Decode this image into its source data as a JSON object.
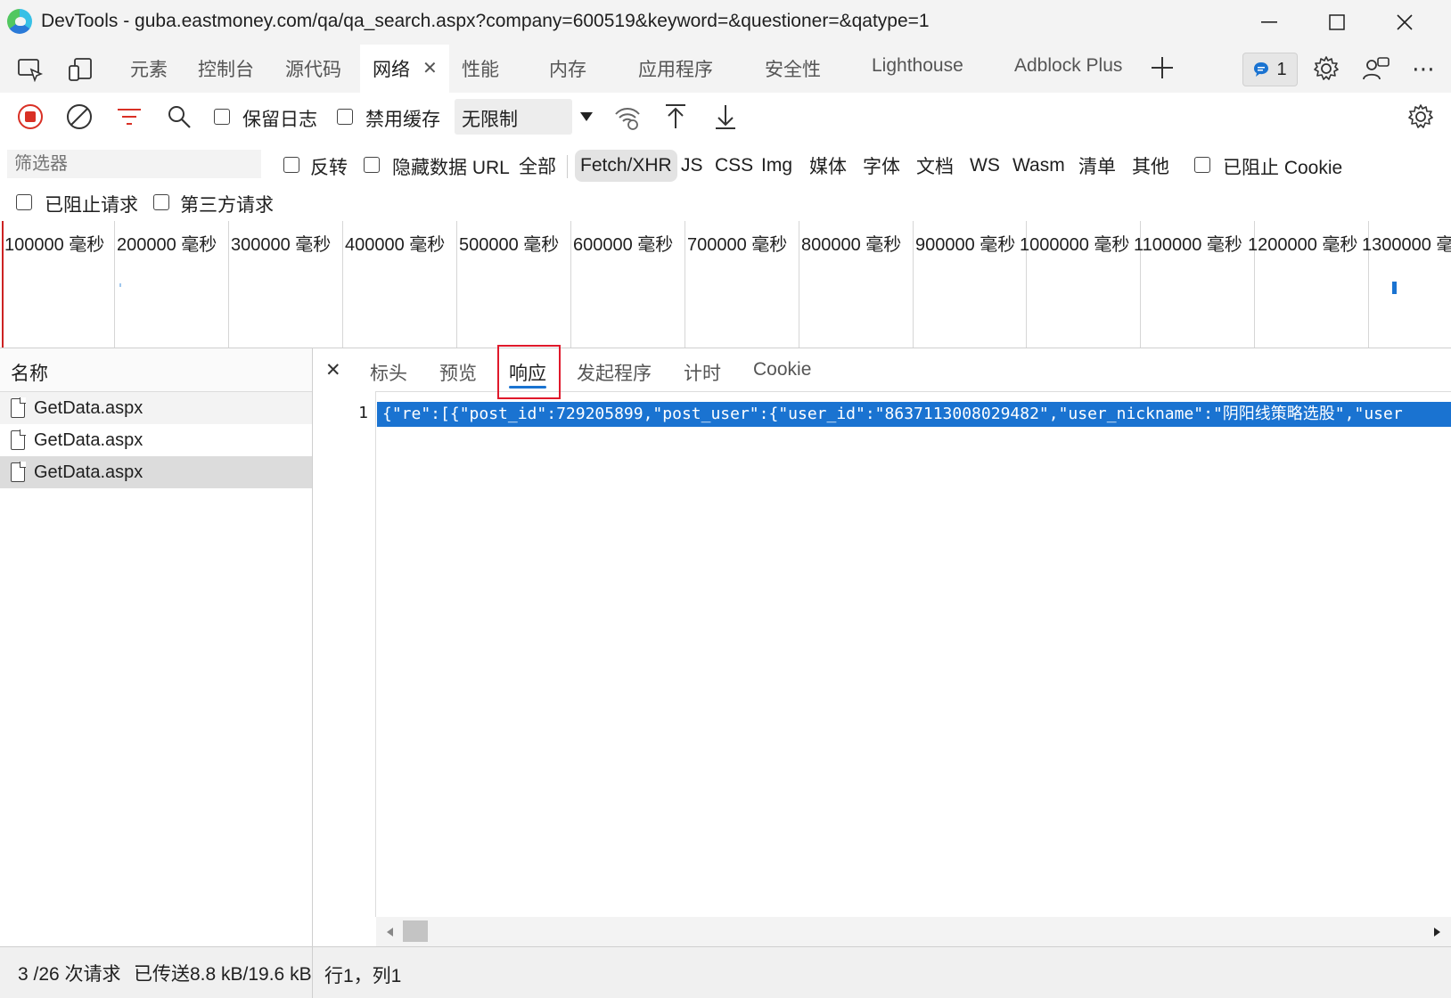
{
  "window": {
    "title": "DevTools - guba.eastmoney.com/qa/qa_search.aspx?company=600519&keyword=&questioner=&qatype=1",
    "minimize": "—",
    "maximize": "☐",
    "close": "✕"
  },
  "tabs": [
    {
      "label": "元素"
    },
    {
      "label": "控制台"
    },
    {
      "label": "源代码"
    },
    {
      "label": "网络",
      "active": true
    },
    {
      "label": "性能"
    },
    {
      "label": "内存"
    },
    {
      "label": "应用程序"
    },
    {
      "label": "安全性"
    },
    {
      "label": "Lighthouse"
    },
    {
      "label": "Adblock Plus"
    }
  ],
  "tab_close": "✕",
  "add_tab": "+",
  "messages_count": "1",
  "toolbar": {
    "preserve_log": "保留日志",
    "disable_cache": "禁用缓存",
    "throttling": "无限制"
  },
  "filter": {
    "placeholder": "筛选器",
    "invert": "反转",
    "hide_data_urls": "隐藏数据 URL",
    "types": [
      "全部",
      "Fetch/XHR",
      "JS",
      "CSS",
      "Img",
      "媒体",
      "字体",
      "文档",
      "WS",
      "Wasm",
      "清单",
      "其他"
    ],
    "active_type": "Fetch/XHR",
    "blocked_cookies": "已阻止 Cookie",
    "blocked_requests": "已阻止请求",
    "third_party": "第三方请求"
  },
  "overview": {
    "ticks": [
      "100000 毫秒",
      "200000 毫秒",
      "300000 毫秒",
      "400000 毫秒",
      "500000 毫秒",
      "600000 毫秒",
      "700000 毫秒",
      "800000 毫秒",
      "900000 毫秒",
      "1000000 毫秒",
      "1100000 毫秒",
      "1200000 毫秒",
      "1300000 毫"
    ]
  },
  "requests": {
    "header": "名称",
    "rows": [
      {
        "name": "GetData.aspx"
      },
      {
        "name": "GetData.aspx"
      },
      {
        "name": "GetData.aspx",
        "selected": true
      }
    ]
  },
  "detail": {
    "close": "✕",
    "tabs": [
      "标头",
      "预览",
      "响应",
      "发起程序",
      "计时",
      "Cookie"
    ],
    "active_tab": "响应",
    "line_number": "1",
    "code": "{\"re\":[{\"post_id\":729205899,\"post_user\":{\"user_id\":\"8637113008029482\",\"user_nickname\":\"阴阳线策略选股\",\"user"
  },
  "status": {
    "requests": "3 /26 次请求",
    "transferred": "已传送8.8 kB/19.6 kB",
    "cursor": "行1，列1"
  },
  "colors": {
    "accent": "#1a73d1",
    "record_red": "#d93025",
    "highlight_box": "#e0192b"
  }
}
